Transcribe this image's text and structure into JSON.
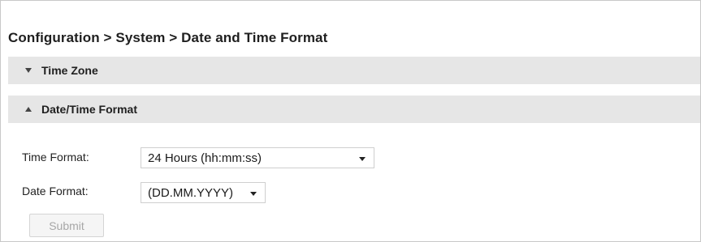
{
  "breadcrumb": "Configuration > System > Date and Time Format",
  "panels": [
    {
      "label": "Time Zone",
      "state": "collapsed"
    },
    {
      "label": "Date/Time Format",
      "state": "expanded"
    }
  ],
  "form": {
    "time_format_label": "Time Format:",
    "time_format_value": "24 Hours (hh:mm:ss)",
    "date_format_label": "Date Format:",
    "date_format_value": "(DD.MM.YYYY)",
    "submit_label": "Submit",
    "submit_enabled": false
  },
  "icons": {
    "time_zone_toggle": "triangle-down-icon",
    "date_time_toggle": "triangle-up-icon",
    "select_caret": "chevron-down-icon"
  },
  "colors": {
    "panel_header_bg": "#e6e6e6",
    "disabled_text": "#a7a7a7"
  }
}
